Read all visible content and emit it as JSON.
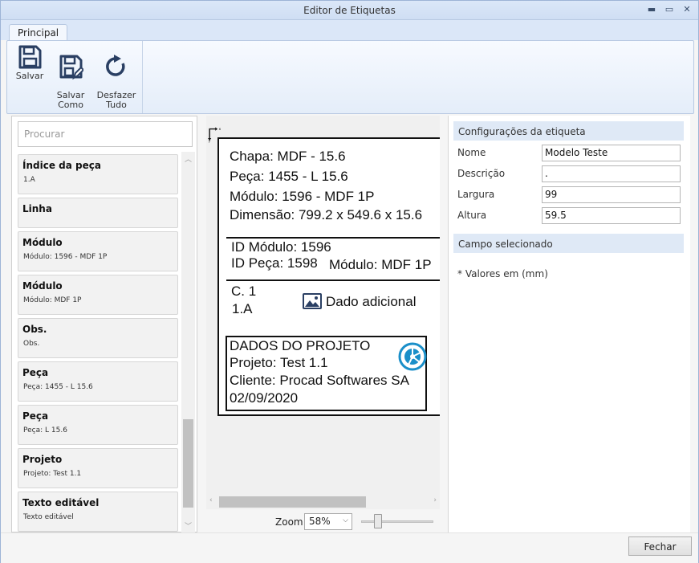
{
  "window": {
    "title": "Editor de Etiquetas",
    "controls": [
      "minimize",
      "maximize",
      "close"
    ]
  },
  "ribbon": {
    "tab": "Principal",
    "buttons": [
      {
        "label": "Salvar",
        "icon": "save-icon"
      },
      {
        "label": "Salvar\nComo",
        "icon": "save-as-icon"
      },
      {
        "label": "Desfazer\nTudo",
        "icon": "undo-all-icon"
      }
    ]
  },
  "search": {
    "placeholder": "Procurar",
    "value": ""
  },
  "fields": [
    {
      "title": "Índice da peça",
      "value": "1.A"
    },
    {
      "title": "Linha",
      "value": ""
    },
    {
      "title": "Módulo",
      "value": "Módulo: 1596 - MDF 1P"
    },
    {
      "title": "Módulo",
      "value": "Módulo: MDF 1P"
    },
    {
      "title": "Obs.",
      "value": "Obs."
    },
    {
      "title": "Peça",
      "value": "Peça: 1455 - L 15.6"
    },
    {
      "title": "Peça",
      "value": "Peça: L 15.6"
    },
    {
      "title": "Projeto",
      "value": "Projeto: Test 1.1"
    },
    {
      "title": "Texto editável",
      "value": "Texto editável"
    }
  ],
  "canvas": {
    "axis_x": "x",
    "axis_y": "y",
    "lines": {
      "chapa": "Chapa: MDF - 15.6",
      "peca": "Peça: 1455 - L 15.6",
      "modulo": "Módulo: 1596 - MDF 1P",
      "dimensao": "Dimensão: 799.2 x 549.6 x 15.6",
      "id_modulo": "ID Módulo: 1596",
      "id_peca": "ID Peça: 1598",
      "modulo2": "Módulo: MDF 1P",
      "c1": "C. 1",
      "indice": "1.A",
      "dado_adicional": "Dado adicional",
      "proj_titulo": "DADOS DO PROJETO",
      "projeto": "Projeto: Test 1.1",
      "cliente": "Cliente: Procad Softwares SA",
      "data": "02/09/2020"
    }
  },
  "zoom": {
    "label": "Zoom",
    "value": "58%",
    "slider_fraction": 0.2
  },
  "properties": {
    "section_label": "Configurações da etiqueta",
    "rows": [
      {
        "label": "Nome",
        "value": "Modelo Teste"
      },
      {
        "label": "Descrição",
        "value": "."
      },
      {
        "label": "Largura",
        "value": "99"
      },
      {
        "label": "Altura",
        "value": "59.5"
      }
    ],
    "selected_section": "Campo selecionado",
    "note": "* Valores em (mm)"
  },
  "footer": {
    "close_label": "Fechar"
  },
  "colors": {
    "accent": "#dfe9f6",
    "ribbon": "#dbe7f8",
    "logo": "#1a8fc9"
  }
}
